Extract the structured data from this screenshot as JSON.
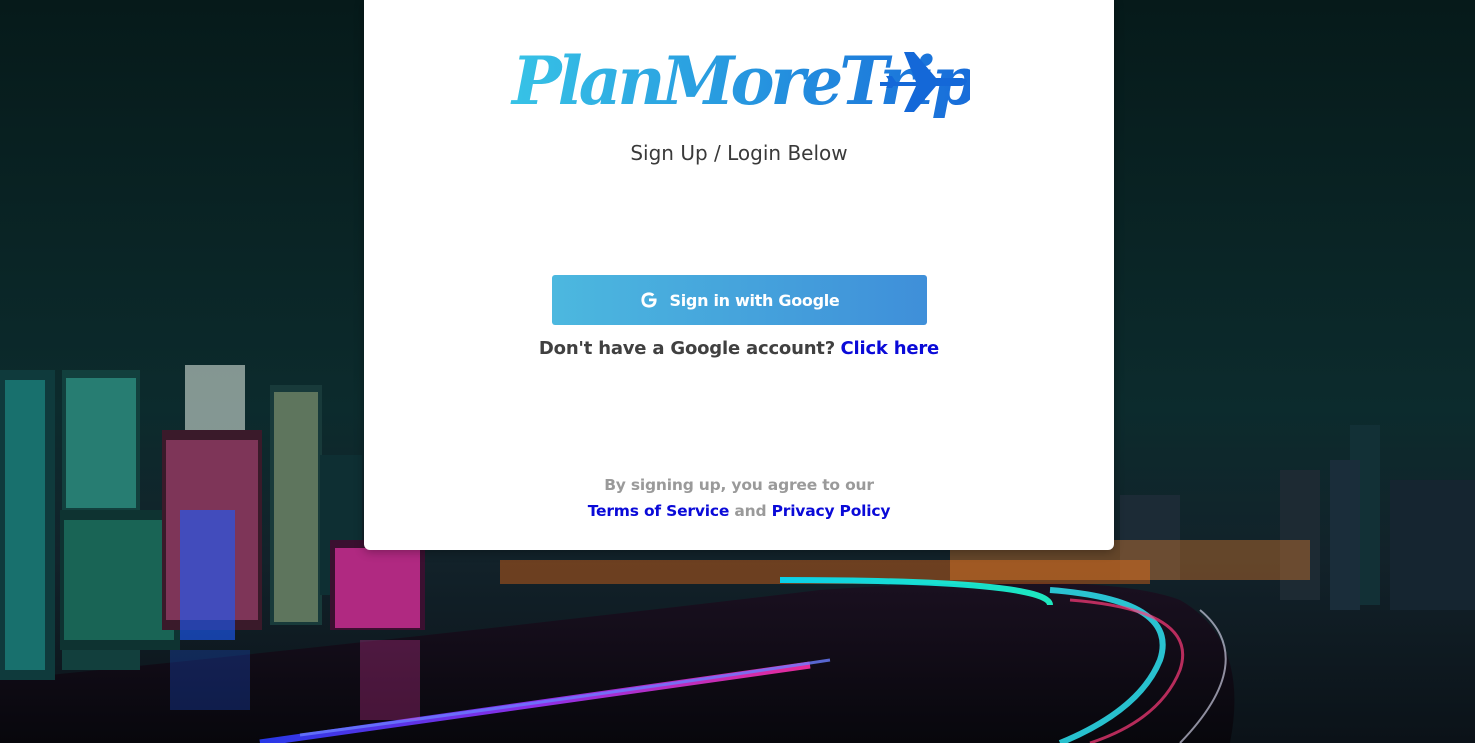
{
  "brand": {
    "logo_text": "PlanMoreTrips",
    "logo_icon": "airplane-icon",
    "colors": {
      "logo_start": "#37c3e6",
      "logo_end": "#1565d8"
    }
  },
  "auth": {
    "subtitle": "Sign Up / Login Below",
    "google_button": {
      "label": "Sign in with Google",
      "icon": "google-g-icon"
    },
    "no_account_text": "Don't have a Google account?",
    "no_account_link": "Click here"
  },
  "legal": {
    "intro": "By signing up, you agree to our",
    "terms_link": "Terms of Service",
    "conjunction": "and",
    "privacy_link": "Privacy Policy"
  },
  "colors": {
    "link": "#0a0ad8",
    "button_start": "#4cb8df",
    "button_end": "#3f8fd9",
    "text": "#3a3a3a",
    "muted": "#9a9a9a"
  }
}
